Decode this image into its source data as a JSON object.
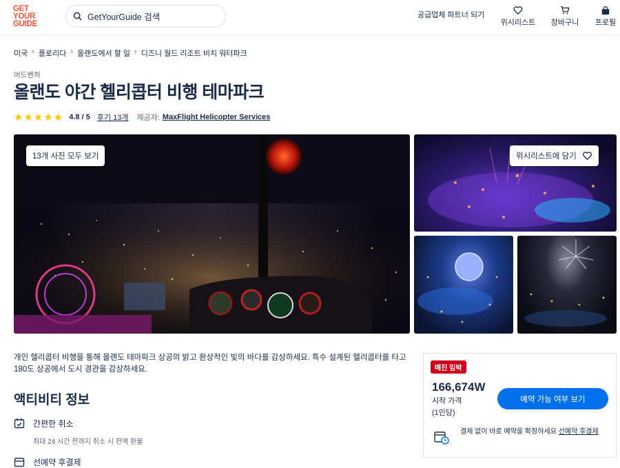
{
  "header": {
    "logo_lines": [
      "GET",
      "YOUR",
      "GUIDE"
    ],
    "search_placeholder": "GetYourGuide 검색",
    "partner_link": "공급업체 파트너 되기",
    "nav": [
      {
        "label": "위시리스트",
        "icon": "heart-icon"
      },
      {
        "label": "장바구니",
        "icon": "cart-icon"
      },
      {
        "label": "프로필",
        "icon": "profile-icon"
      }
    ]
  },
  "breadcrumb": [
    "미국",
    "플로리다",
    "올랜도에서 할 일",
    "디즈니 월드 리조트 비치 워터파크"
  ],
  "breadcrumb_sep": "›",
  "category": "어드벤처",
  "title": "올랜도 야간 헬리콥터 비행 테마파크",
  "rating": {
    "stars": "★★★★★",
    "score": "4.8 / 5",
    "reviews": "후기 13개",
    "provider_label": "제공자:",
    "provider": "MaxFlight Helicopter Services"
  },
  "gallery": {
    "view_all": "13개 사진 모두 보기",
    "wishlist": "위시리스트에 담기"
  },
  "description": "개인 헬리콥터 비행을 통해 올랜도 테마파크 상공의 밝고 환상적인 빛의 바다를 감상하세요. 특수 설계된 헬리콥터를 타고 180도 상공에서 도시 경관을 감상하세요.",
  "info": {
    "heading": "액티비티 정보",
    "features": [
      {
        "title": "간편한 취소",
        "subtitle": "최대 24 시간 전까지 취소 시 전액 환불",
        "icon": "calendar-check-icon"
      },
      {
        "title": "선예약 후결제",
        "subtitle": "",
        "icon": "calendar-pay-icon"
      }
    ]
  },
  "booking": {
    "badge": "매진 임박",
    "price": "166,674W",
    "price_label_line1": "시작 가격",
    "price_label_line2": "(1인당)",
    "cta": "예약 가능 여부 보기",
    "note_text": "결제 없이 바로 예약을 확정하세요 ",
    "note_link": "선예약 후결제"
  },
  "colors": {
    "brand": "#ff5533",
    "primary_button": "#0071eb",
    "badge": "#d0021b",
    "star": "#ffc700",
    "text": "#1a2b49"
  }
}
